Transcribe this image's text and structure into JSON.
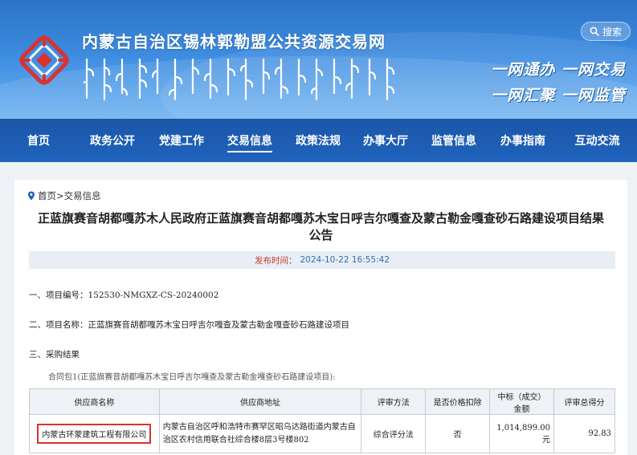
{
  "header": {
    "site_title": "内蒙古自治区锡林郭勒盟公共资源交易网",
    "search_label": "搜索",
    "slogan_line1": "一网通办 一网交易",
    "slogan_line2": "一网汇聚 一网监管"
  },
  "nav": {
    "items": [
      {
        "label": "首页"
      },
      {
        "label": "政务公开"
      },
      {
        "label": "党建工作"
      },
      {
        "label": "交易信息"
      },
      {
        "label": "政策法规"
      },
      {
        "label": "办事大厅"
      },
      {
        "label": "监管信息"
      },
      {
        "label": "办事指南"
      },
      {
        "label": "互动交流"
      }
    ],
    "active_index": 3
  },
  "breadcrumb": {
    "home": "首页",
    "sep": ">",
    "current": "交易信息"
  },
  "article": {
    "title_line1": "正蓝旗赛音胡都嘎苏木人民政府正蓝旗赛音胡都嘎苏木宝日呼吉尔嘎查及蒙古勒金嘎查砂石路建设项目结果",
    "title_line2": "公告",
    "publish_label": "发布时间：",
    "publish_time": "2024-10-22 16:55:42",
    "section1": "一、项目编号：152530-NMGXZ-CS-20240002",
    "section2": "二、项目名称：正蓝旗赛音胡都嘎苏木宝日呼吉尔嘎查及蒙古勒金嘎查砂石路建设项目",
    "section3": "三、采购结果",
    "package": "合同包1(正蓝旗赛音胡都嘎苏木宝日呼吉尔嘎查及蒙古勒金嘎查砂石路建设项目):"
  },
  "results_table": {
    "headers": {
      "supplier": "供应商名称",
      "address": "供应商地址",
      "method": "评审方法",
      "deduction": "是否价格扣除",
      "amount_line1": "中标（成交）",
      "amount_line2": "金额",
      "score": "评审总得分"
    },
    "rows": [
      {
        "supplier": "内蒙古环蒙建筑工程有限公司",
        "address": "内蒙古自治区呼和浩特市赛罕区昭乌达路街道内蒙古自治区农村信用联合社综合楼8层3号楼802",
        "method": "综合评分法",
        "deduction": "否",
        "amount": "1,014,899.00元",
        "score": "92.83"
      }
    ]
  },
  "colors": {
    "banner_top": "#2b73c8",
    "nav": "#1b57a8",
    "logo_red": "#d9322f",
    "publish_label": "#c0392b",
    "publish_time": "#2f6db3",
    "highlight_box": "#d9322f"
  }
}
